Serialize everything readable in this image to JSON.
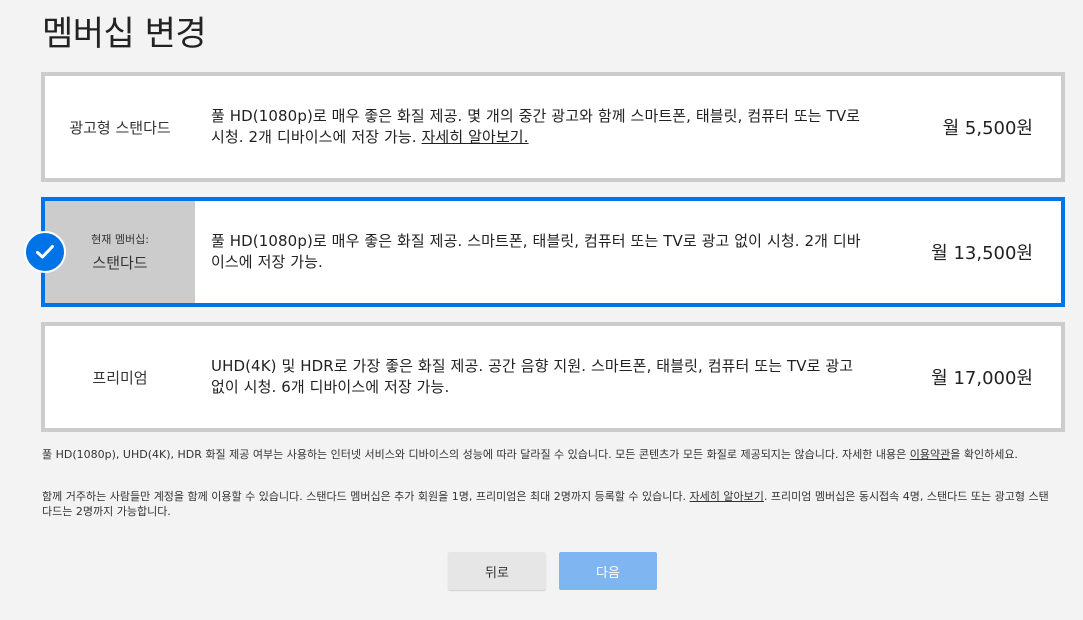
{
  "page": {
    "title": "멤버십 변경"
  },
  "colors": {
    "accent": "#0073e6",
    "border": "#cccccc",
    "next_disabled": "#7fb5f0"
  },
  "plans": [
    {
      "name": "광고형 스탠다드",
      "description": "풀 HD(1080p)로 매우 좋은 화질 제공. 몇 개의 중간 광고와 함께 스마트폰, 태블릿, 컴퓨터 또는 TV로 시청. 2개 디바이스에 저장 가능.",
      "link": "자세히 알아보기.",
      "price": "월 5,500원"
    },
    {
      "current_label": "현재 멤버십:",
      "name": "스탠다드",
      "description": "풀 HD(1080p)로 매우 좋은 화질 제공. 스마트폰, 태블릿, 컴퓨터 또는 TV로 광고 없이 시청. 2개 디바이스에 저장 가능.",
      "price": "월 13,500원",
      "selected": true,
      "icon": "check-icon"
    },
    {
      "name": "프리미엄",
      "description": "UHD(4K) 및 HDR로 가장 좋은 화질 제공. 공간 음향 지원. 스마트폰, 태블릿, 컴퓨터 또는 TV로 광고 없이 시청. 6개 디바이스에 저장 가능.",
      "price": "월 17,000원"
    }
  ],
  "footnotes": {
    "quality_text": "풀 HD(1080p), UHD(4K), HDR 화질 제공 여부는 사용하는 인터넷 서비스와 디바이스의 성능에 따라 달라질 수 있습니다. 모든 콘텐츠가 모든 화질로 제공되지는 않습니다. 자세한 내용은 ",
    "terms_link": "이용약관",
    "quality_text_end": "을 확인하세요.",
    "household_text": "함께 거주하는 사람들만 계정을 함께 이용할 수 있습니다. 스탠다드 멤버십은 추가 회원을 1명, 프리미엄은 최대 2명까지 등록할 수 있습니다. ",
    "learn_more_link": "자세히 알아보기",
    "household_text_end": ". 프리미엄 멤버십은 동시접속 4명, 스탠다드 또는 광고형 스탠다드는 2명까지 가능합니다."
  },
  "buttons": {
    "back": "뒤로",
    "next": "다음"
  }
}
